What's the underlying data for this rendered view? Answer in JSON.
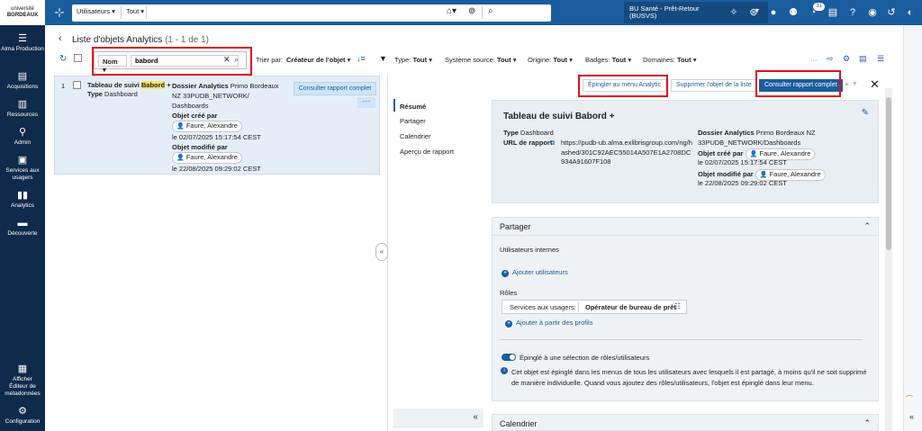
{
  "logo": {
    "line1": "université",
    "line2": "BORDEAUX"
  },
  "leftnav": [
    {
      "label": "Alma Production",
      "icon": "menu-icon"
    },
    {
      "label": "Acquisitions",
      "icon": "book-icon"
    },
    {
      "label": "Ressources",
      "icon": "library-icon"
    },
    {
      "label": "Admin",
      "icon": "key-icon"
    },
    {
      "label": "Services aux usagers",
      "icon": "inbox-icon"
    },
    {
      "label": "Analytics",
      "icon": "chart-icon"
    },
    {
      "label": "Découverte",
      "icon": "discover-icon"
    },
    {
      "label": "Afficher Éditeur de métadonnées",
      "icon": "metadata-icon"
    },
    {
      "label": "Configuration",
      "icon": "gear-icon"
    }
  ],
  "topbar": {
    "search_scope": "Utilisateurs",
    "search_field": "Tout",
    "institution": "BU Santé - Prêt-Retour (BUSVS)",
    "notifications_count": "31"
  },
  "page": {
    "title": "Liste d'objets Analytics",
    "count": "(1 - 1 de 1)"
  },
  "toolbar": {
    "search_field": "Nom",
    "search_value": "babord",
    "sort_label": "Trier par:",
    "sort_value": "Créateur de l'objet",
    "filters": [
      {
        "label": "Type:",
        "value": "Tout"
      },
      {
        "label": "Système source:",
        "value": "Tout"
      },
      {
        "label": "Origine:",
        "value": "Tout"
      },
      {
        "label": "Badges:",
        "value": "Tout"
      },
      {
        "label": "Domaines:",
        "value": "Tout"
      }
    ]
  },
  "list": {
    "row": {
      "number": "1",
      "title_pre": "Tableau de suivi ",
      "title_hl": "Babord",
      "title_post": " +",
      "type_label": "Type",
      "type_value": "Dashboard",
      "folder_label": "Dossier Analytics",
      "folder_value": "Primo Bordeaux NZ 33PUDB_NETWORK/ Dashboards",
      "created_label": "Objet créé par",
      "created_user": "Faure, Alexandre",
      "created_date": "le 02/07/2025 15:17:54 CEST",
      "modified_label": "Objet modifié par",
      "modified_user": "Faure, Alexandre",
      "modified_date": "le 22/08/2025 09:29:02 CEST",
      "consult_label": "Consulter rapport complet"
    }
  },
  "detail": {
    "actions": {
      "pin": "Épingler au menu Analytic",
      "delete": "Supprimer l'objet de la liste",
      "full": "Consulter rapport complet"
    },
    "menu": [
      "Résumé",
      "Partager",
      "Calendrier",
      "Aperçu de rapport"
    ],
    "summary": {
      "title": "Tableau de suivi Babord +",
      "type_label": "Type",
      "type_value": "Dashboard",
      "url_label": "URL de rapport",
      "url_value": "https://pudb-ub.alma.exlibrisgroup.com/ng/hashed/301C92AEC55014A507E1A2708DC934A91607F108",
      "folder_label": "Dossier Analytics",
      "folder_value": "Primo Bordeaux NZ 33PUDB_NETWORK/Dashboards",
      "created_label": "Objet créé par",
      "created_user": "Faure, Alexandre",
      "created_date": "le 02/07/2025 15:17:54 CEST",
      "modified_label": "Objet modifié par",
      "modified_user": "Faure, Alexandre",
      "modified_date": "le 22/08/2025 09:29:02 CEST"
    },
    "share": {
      "title": "Partager",
      "internal_users": "Utilisateurs internes",
      "add_users": "Ajouter utilisateurs",
      "roles": "Rôles",
      "role_scope": "Services aux usagers:",
      "role_name": "Opérateur de bureau de prêt",
      "add_from_profiles": "Ajouter à partir des profils",
      "pinned_toggle": "Épinglé à une sélection de rôles/utilisateurs",
      "info": "Cet objet est épinglé dans les menus de tous les utilisateurs avec lesquels il est partagé, à moins qu'il ne soit supprimé de manière individuelle. Quand vous ajoutez des rôles/utilisateurs, l'objet est épinglé dans leur menu."
    },
    "calendar_title": "Calendrier"
  }
}
